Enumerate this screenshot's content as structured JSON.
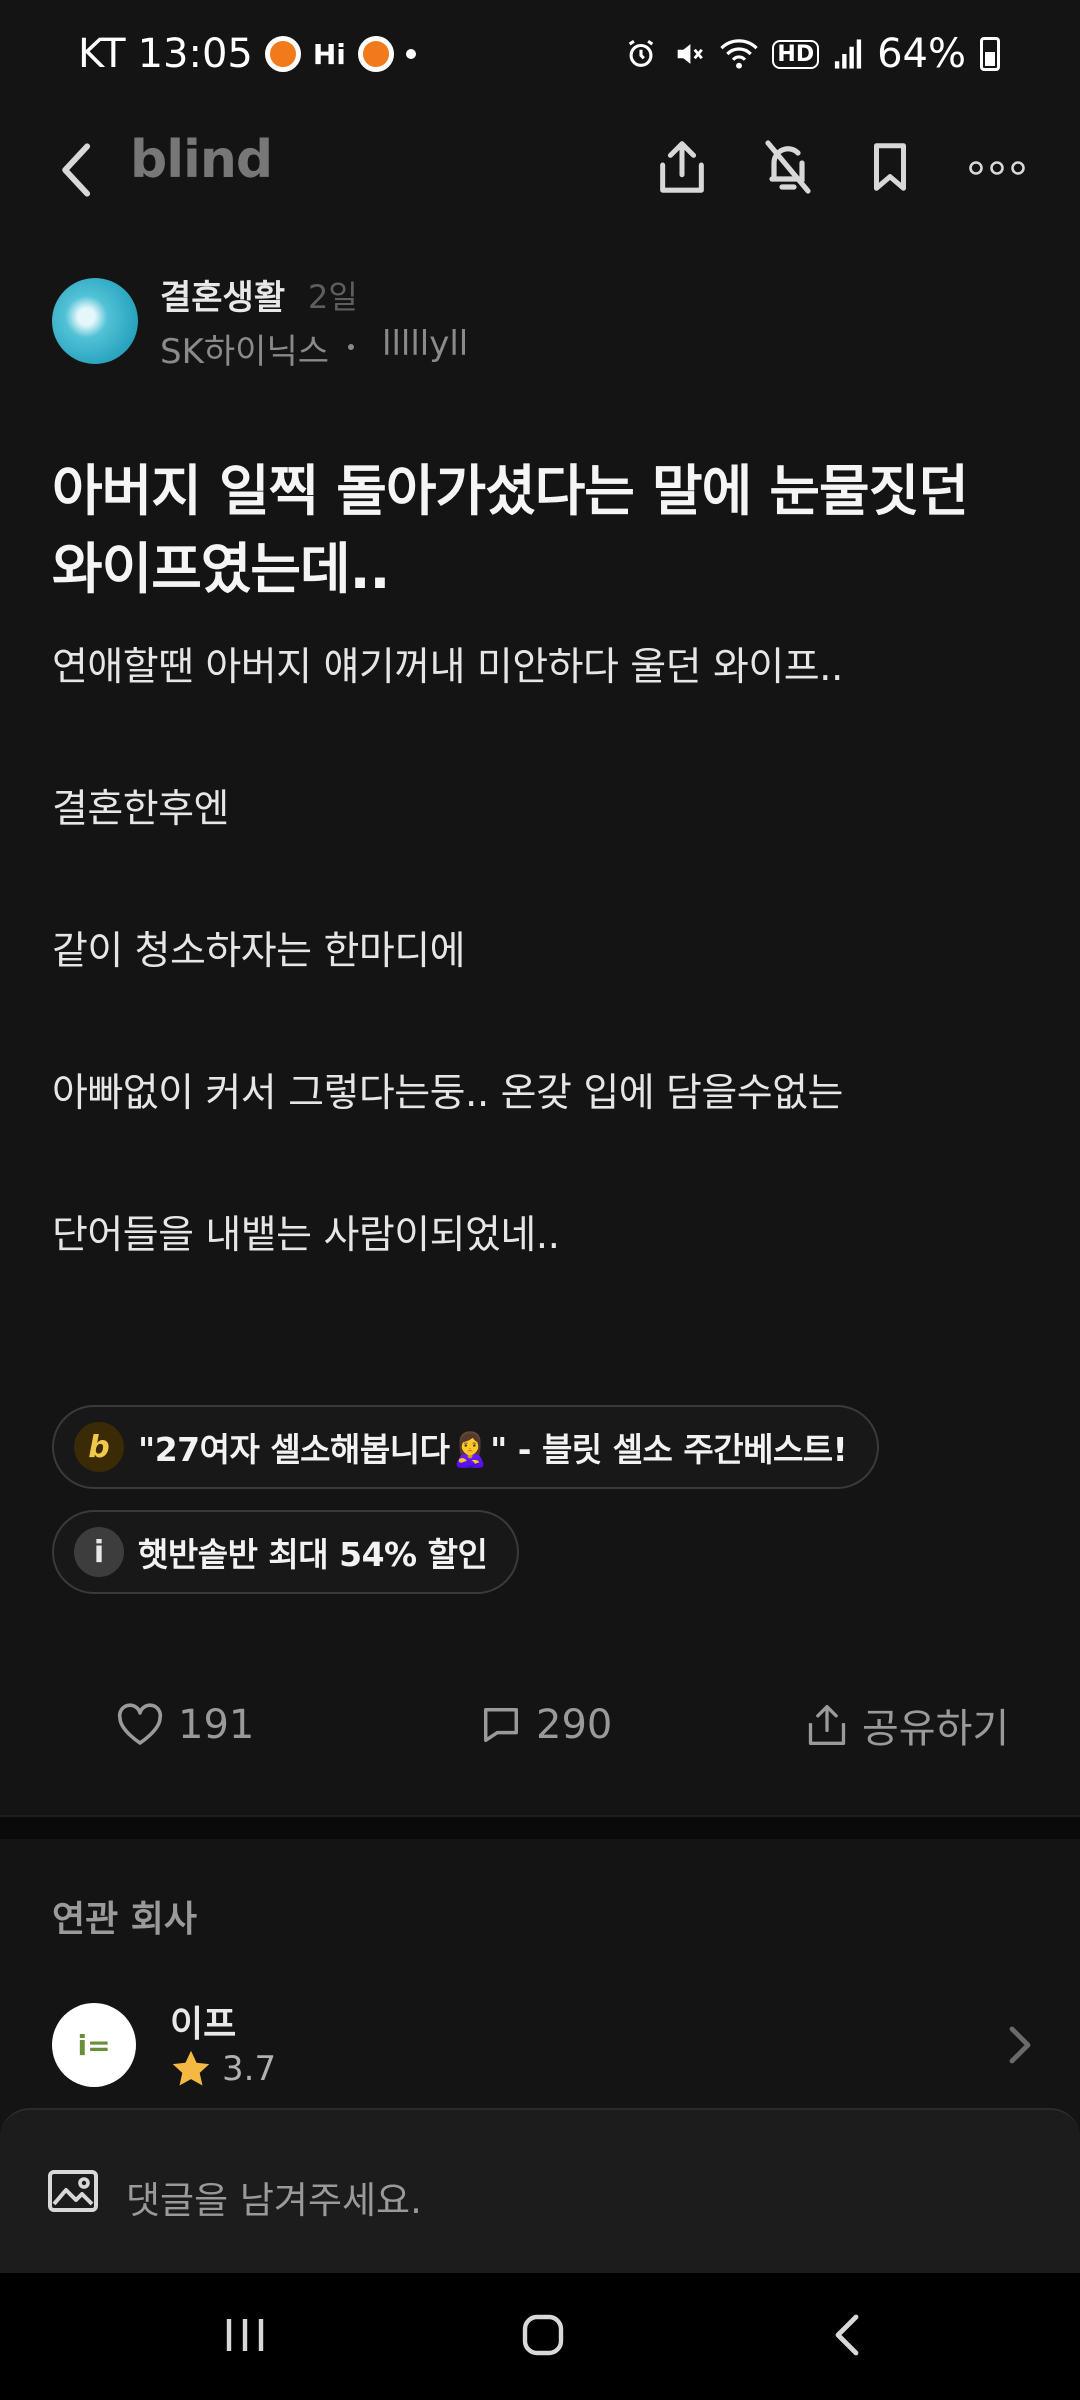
{
  "status": {
    "carrier": "KT",
    "time": "13:05",
    "notif_hi": "Hi",
    "hd": "HD",
    "battery": "64%"
  },
  "nav": {
    "brand": "blind",
    "icons": [
      "back-icon",
      "share-icon",
      "bell-off-icon",
      "bookmark-icon",
      "more-icon"
    ]
  },
  "author": {
    "board": "결혼생활",
    "time_ago": "2일",
    "company": "SK하이닉스",
    "nickname": "lllllyll"
  },
  "post": {
    "title_line1": "아버지 일찍 돌아가셨다는 말에 눈물짓던",
    "title_line2": "와이프였는데..",
    "body": [
      "연애할땐 아버지 얘기꺼내 미안하다 울던 와이프..",
      "결혼한후엔",
      "같이 청소하자는 한마디에",
      "아빠없이 커서 그렇다는둥.. 온갖 입에 담을수없는",
      "단어들을 내뱉는 사람이되었네.."
    ]
  },
  "chips": {
    "chip1_icon": "b",
    "chip1_text": "\"27여자 셀소해봅니다🙎‍♀️\" - 블릿 셀소 주간베스트!",
    "chip2_icon": "i",
    "chip2_text": "햇반솥반 최대 54% 할인"
  },
  "actions": {
    "likes": "191",
    "comments": "290",
    "share": "공유하기"
  },
  "related": {
    "title": "연관 회사",
    "company_name": "이프",
    "rating": "3.7",
    "logo_text": "i="
  },
  "comment": {
    "placeholder": "댓글을 남겨주세요."
  },
  "colors": {
    "background": "#141414",
    "star": "#f4b942",
    "notif_orange": "#f07a1c"
  }
}
